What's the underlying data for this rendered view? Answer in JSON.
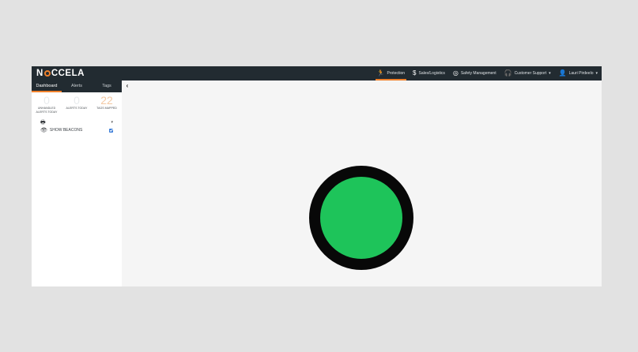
{
  "app": {
    "logo": {
      "prefix": "N",
      "suffix": "CCELA"
    },
    "nav": [
      {
        "icon": "running-person-icon",
        "glyph": "🏃",
        "label": "Protection",
        "active": true
      },
      {
        "icon": "dollar-icon",
        "glyph": "$",
        "label": "Sales/Logistics"
      },
      {
        "icon": "gauge-icon",
        "glyph": "◎",
        "label": "Safety Management"
      },
      {
        "icon": "headset-icon",
        "glyph": "🎧",
        "label": "Customer Support",
        "caret": "▾"
      },
      {
        "icon": "user-icon",
        "glyph": "👤",
        "label": "Lauri Pirdeelo",
        "caret": "▾"
      }
    ]
  },
  "sidebar": {
    "tabs": [
      "Dashboard",
      "Alerts",
      "Tags"
    ],
    "active_tab": 0,
    "stats": [
      {
        "value": "0",
        "label": "UNHANDLED ALERTS TODAY"
      },
      {
        "value": "0",
        "label": "ALERTS TODAY"
      },
      {
        "value": "22",
        "label": "TAGS MAPPED"
      }
    ],
    "tools": {
      "print_icon": "printer-icon",
      "show_beacons_label": "SHOW BEACONS",
      "show_beacons_checked": true
    },
    "collapse_icon": "‹"
  },
  "map": {
    "status_color": "#1ec45a",
    "ring_color": "#080808"
  },
  "colors": {
    "topbar": "#222b31",
    "accent": "#f0812c",
    "page_bg": "#e2e2e2"
  }
}
